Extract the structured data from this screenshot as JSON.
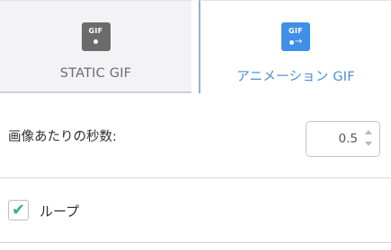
{
  "tabs": [
    {
      "label": "STATIC GIF",
      "icon": "static-gif-icon",
      "icon_text": "GIF",
      "selected": false
    },
    {
      "label": "アニメーション GIF",
      "icon": "animated-gif-icon",
      "icon_text": "GIF",
      "selected": true
    }
  ],
  "colors": {
    "accent": "#4d8fd6",
    "icon_blue": "#3f8fe6",
    "icon_gray": "#6b6b6b",
    "check": "#2fb77a"
  },
  "settings": {
    "seconds_per_frame_label": "画像あたりの秒数:",
    "seconds_per_frame_value": "0.5",
    "loop_label": "ループ",
    "loop_checked": true
  }
}
